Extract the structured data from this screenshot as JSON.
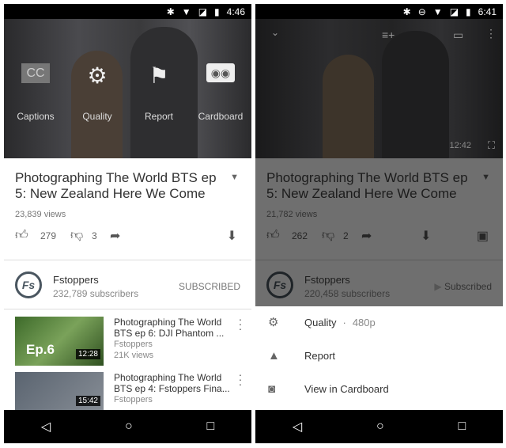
{
  "left": {
    "status": {
      "time": "4:46"
    },
    "video_menu": [
      {
        "icon": "cc-icon",
        "glyph": "CC",
        "label": "Captions"
      },
      {
        "icon": "gear-icon",
        "glyph": "⚙",
        "label": "Quality"
      },
      {
        "icon": "flag-icon",
        "glyph": "⚑",
        "label": "Report"
      },
      {
        "icon": "cardboard-icon",
        "glyph": "◉◉",
        "label": "Cardboard"
      }
    ],
    "title": "Photographing The World BTS ep 5: New Zealand Here We Come",
    "views": "23,839 views",
    "likes": "279",
    "dislikes": "3",
    "channel": {
      "name": "Fstoppers",
      "subscribers": "232,789 subscribers",
      "button": "SUBSCRIBED",
      "avatar": "Fs"
    },
    "related": [
      {
        "title": "Photographing The World BTS ep 6: DJI Phantom ...",
        "channel": "Fstoppers",
        "views": "21K views",
        "duration": "12:28",
        "overlay": "Ep.6"
      },
      {
        "title": "Photographing The World BTS ep 4: Fstoppers Fina...",
        "channel": "Fstoppers",
        "duration": "15:42"
      }
    ]
  },
  "right": {
    "status": {
      "time": "6:41"
    },
    "video": {
      "duration": "12:42"
    },
    "title": "Photographing The World BTS ep 5: New Zealand Here We Come",
    "views": "21,782 views",
    "likes": "262",
    "dislikes": "2",
    "channel": {
      "name": "Fstoppers",
      "subscribers": "220,458 subscribers",
      "button": "Subscribed",
      "avatar": "Fs"
    },
    "sheet": {
      "quality": "Quality",
      "quality_sep": "·",
      "quality_value": "480p",
      "report": "Report",
      "cardboard": "View in Cardboard"
    }
  }
}
